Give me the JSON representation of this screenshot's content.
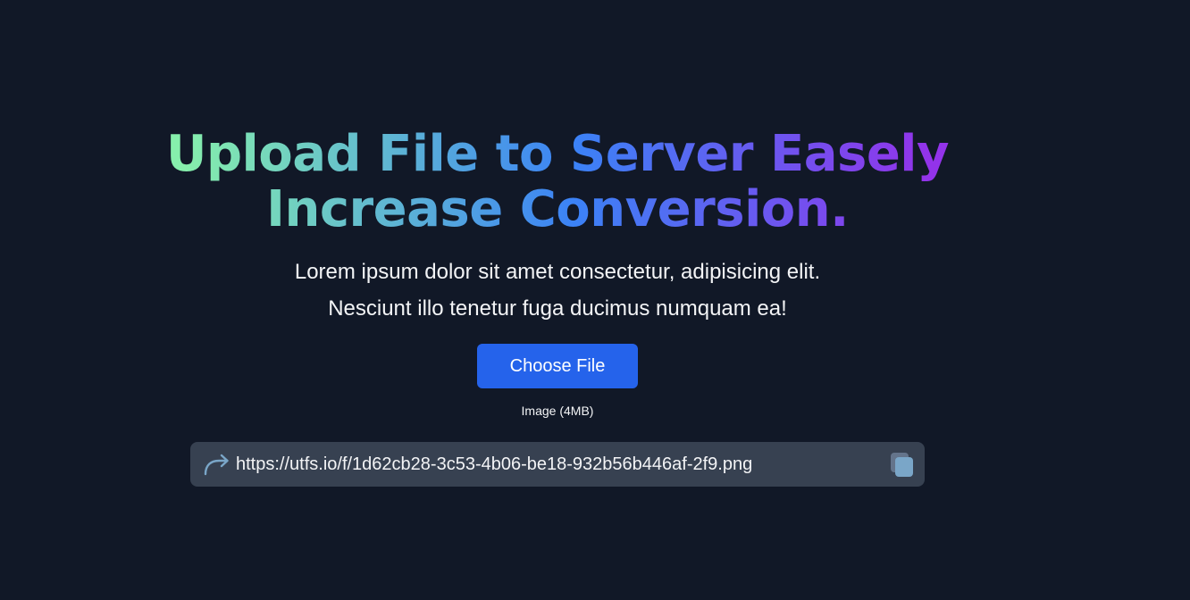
{
  "hero": {
    "title_line1": "Upload File to Server Easely",
    "title_line2": "Increase Conversion."
  },
  "subtitle": {
    "line1": "Lorem ipsum dolor sit amet consectetur, adipisicing elit.",
    "line2": "Nesciunt illo tenetur fuga ducimus numquam ea!"
  },
  "upload": {
    "button_label": "Choose File",
    "hint": "Image (4MB)"
  },
  "result": {
    "url": "https://utfs.io/f/1d62cb28-3c53-4b06-be18-932b56b446af-2f9.png",
    "arrow_icon": "share-arrow-icon",
    "copy_icon": "copy-icon"
  },
  "colors": {
    "background": "#111827",
    "button": "#2563eb",
    "url_bar": "#374151",
    "gradient_start": "#86efac",
    "gradient_mid": "#3b82f6",
    "gradient_end": "#9333ea"
  }
}
